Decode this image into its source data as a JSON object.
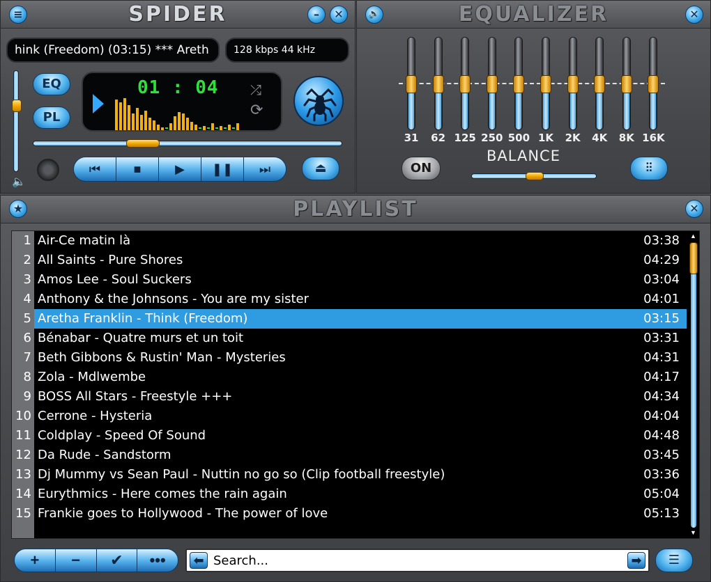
{
  "player": {
    "title": "SPIDER",
    "track_scroll": "hink (Freedom) (03:15) *** Areth",
    "bitrate": "128 kbps 44 kHz",
    "time": "01 : 04",
    "eq_button": "EQ",
    "pl_button": "PL",
    "volume_level": 0.68,
    "position_level": 0.3
  },
  "equalizer": {
    "title": "EQUALIZER",
    "bands": [
      {
        "label": "31",
        "level": 0.5
      },
      {
        "label": "62",
        "level": 0.5
      },
      {
        "label": "125",
        "level": 0.5
      },
      {
        "label": "250",
        "level": 0.5
      },
      {
        "label": "500",
        "level": 0.5
      },
      {
        "label": "1K",
        "level": 0.5
      },
      {
        "label": "2K",
        "level": 0.5
      },
      {
        "label": "4K",
        "level": 0.5
      },
      {
        "label": "8K",
        "level": 0.5
      },
      {
        "label": "16K",
        "level": 0.5
      }
    ],
    "on_button": "ON",
    "balance_label": "BALANCE",
    "balance_level": 0.5
  },
  "playlist": {
    "title": "PLAYLIST",
    "rows": [
      {
        "num": "1",
        "title": "Air-Ce matin là",
        "dur": "03:38"
      },
      {
        "num": "2",
        "title": "All Saints - Pure Shores",
        "dur": "04:29"
      },
      {
        "num": "3",
        "title": "Amos Lee - Soul Suckers",
        "dur": "03:04"
      },
      {
        "num": "4",
        "title": "Anthony & the Johnsons - You are my sister",
        "dur": "04:01"
      },
      {
        "num": "5",
        "title": "Aretha Franklin - Think (Freedom)",
        "dur": "03:15",
        "selected": true
      },
      {
        "num": "6",
        "title": "Bénabar - Quatre murs et un toit",
        "dur": "03:31"
      },
      {
        "num": "7",
        "title": "Beth Gibbons & Rustin' Man - Mysteries",
        "dur": "04:31"
      },
      {
        "num": "8",
        "title": "Zola - Mdlwembe",
        "dur": "04:17"
      },
      {
        "num": "9",
        "title": "BOSS All Stars - Freestyle +++",
        "dur": "04:34"
      },
      {
        "num": "10",
        "title": "Cerrone - Hysteria",
        "dur": "04:04"
      },
      {
        "num": "11",
        "title": "Coldplay - Speed Of Sound",
        "dur": "04:48"
      },
      {
        "num": "12",
        "title": "Da Rude - Sandstorm",
        "dur": "03:45"
      },
      {
        "num": "13",
        "title": "Dj Mummy vs Sean Paul - Nuttin no go so (Clip football freestyle)",
        "dur": "03:36"
      },
      {
        "num": "14",
        "title": "Eurythmics - Here comes the rain again",
        "dur": "05:04"
      },
      {
        "num": "15",
        "title": "Frankie goes to Hollywood - The power of love",
        "dur": "05:13"
      }
    ],
    "search_value": "Search..."
  }
}
